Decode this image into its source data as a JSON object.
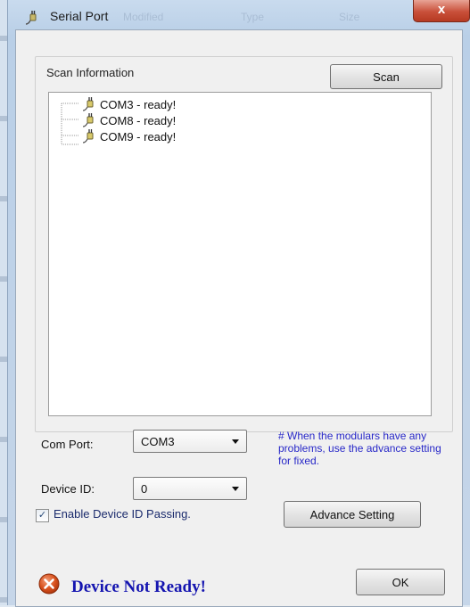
{
  "window": {
    "title": "Serial Port",
    "close_label": "x",
    "ghost_headers": [
      "Modified",
      "Type",
      "Size"
    ]
  },
  "scan": {
    "group_label": "Scan Information",
    "scan_button": "Scan",
    "ports": [
      {
        "label": "COM3 - ready!"
      },
      {
        "label": "COM8 - ready!"
      },
      {
        "label": "COM9 - ready!"
      }
    ]
  },
  "settings": {
    "com_port_label": "Com Port:",
    "com_port_value": "COM3",
    "device_id_label": "Device ID:",
    "device_id_value": "0",
    "hint": "# When the modulars have any problems, use the advance setting for fixed.",
    "enable_passing_label": "Enable Device ID Passing.",
    "enable_passing_checked": true,
    "advance_button": "Advance Setting"
  },
  "footer": {
    "status": "Device Not Ready!",
    "ok_button": "OK",
    "status_color": "#1515b0",
    "error_icon": "error-x-icon"
  }
}
